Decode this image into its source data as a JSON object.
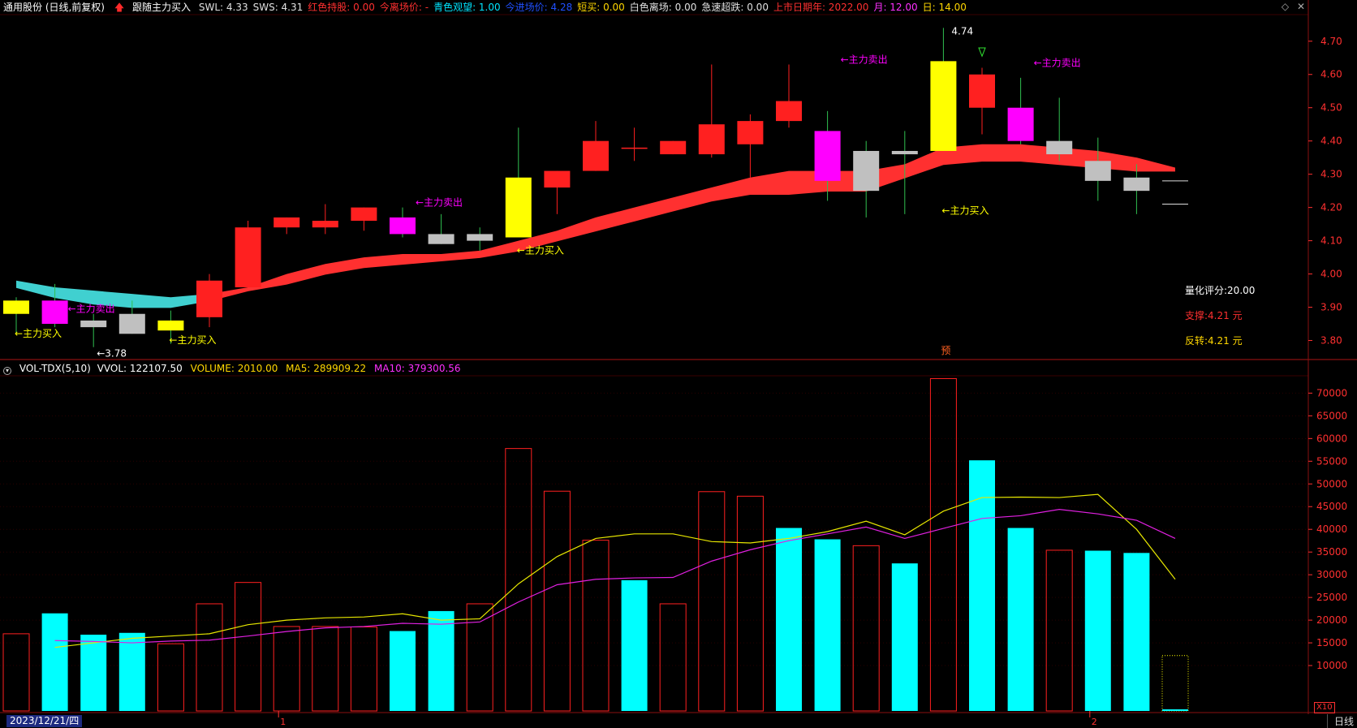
{
  "header": {
    "stock_title": "通用股份 (日线,前复权)",
    "indicator_name": "跟随主力买入",
    "items": [
      {
        "label": "SWL: 4.33",
        "color": "#e0e0e0"
      },
      {
        "label": "SWS: 4.31",
        "color": "#e0e0e0"
      },
      {
        "label": "红色持股: 0.00",
        "color": "#ff3030"
      },
      {
        "label": "今离场价: -",
        "color": "#ff3030"
      },
      {
        "label": "青色观望: 1.00",
        "color": "#00e5ff"
      },
      {
        "label": "今进场价: 4.28",
        "color": "#2050ff"
      },
      {
        "label": "短买: 0.00",
        "color": "#ffd700"
      },
      {
        "label": "白色离场: 0.00",
        "color": "#e0e0e0"
      },
      {
        "label": "急速超跌: 0.00",
        "color": "#e0e0e0"
      },
      {
        "label": "上市日期年: 2022.00",
        "color": "#ff3030"
      },
      {
        "label": "月: 12.00",
        "color": "#ff30ff"
      },
      {
        "label": "日: 14.00",
        "color": "#ffd700"
      }
    ]
  },
  "vol_header": {
    "name": "VOL-TDX(5,10)",
    "vvol": "VVOL: 122107.50",
    "volume": "VOLUME: 2010.00",
    "ma5": "MA5: 289909.22",
    "ma10": "MA10: 379300.56"
  },
  "window_icons": [
    "diamond-icon",
    "close-icon"
  ],
  "window_icon_glyphs": [
    "◇",
    "✕"
  ],
  "footer": {
    "date": "2023/12/21/四",
    "period": "日线",
    "axis_multiplier": "X10",
    "month_markers": [
      "1",
      "2"
    ]
  },
  "colors": {
    "up": "#ff2020",
    "down_cyan": "#00ffff",
    "buy_yellow": "#ffff00",
    "sell_magenta": "#ff00ff",
    "neutral_gray": "#c0c0c0",
    "band_red": "#ff3030",
    "band_cyan": "#40d0d0",
    "ma5": "#e6e600",
    "ma10": "#e020e0",
    "axis_text": "#ff3030",
    "grid": "#3a0000"
  },
  "annotations": {
    "buy_signal": "←主力买入",
    "sell_signal": "←主力卖出",
    "low_label": "←3.78",
    "high_label": "4.74",
    "pre_marker": "预"
  },
  "stats": {
    "score": "量化评分:20.00",
    "support": "支撑:4.21 元",
    "reversal": "反转:4.21 元"
  },
  "chart_data": [
    {
      "type": "candlestick",
      "y_axis_ticks": [
        "4.70",
        "4.60",
        "4.50",
        "4.40",
        "4.30",
        "4.20",
        "4.10",
        "4.00",
        "3.90",
        "3.80"
      ],
      "ylim": [
        3.75,
        4.78
      ],
      "candles": [
        {
          "o": 3.88,
          "h": 3.93,
          "l": 3.82,
          "c": 3.92,
          "color": "yellow"
        },
        {
          "o": 3.92,
          "h": 3.97,
          "l": 3.84,
          "c": 3.85,
          "color": "magenta"
        },
        {
          "o": 3.86,
          "h": 3.88,
          "l": 3.78,
          "c": 3.84,
          "color": "gray"
        },
        {
          "o": 3.82,
          "h": 3.92,
          "l": 3.82,
          "c": 3.88,
          "color": "gray"
        },
        {
          "o": 3.86,
          "h": 3.89,
          "l": 3.79,
          "c": 3.83,
          "color": "yellow"
        },
        {
          "o": 3.87,
          "h": 4.0,
          "l": 3.84,
          "c": 3.98,
          "color": "red"
        },
        {
          "o": 3.96,
          "h": 4.16,
          "l": 3.96,
          "c": 4.14,
          "color": "red"
        },
        {
          "o": 4.14,
          "h": 4.17,
          "l": 4.12,
          "c": 4.17,
          "color": "red"
        },
        {
          "o": 4.14,
          "h": 4.21,
          "l": 4.12,
          "c": 4.16,
          "color": "red"
        },
        {
          "o": 4.16,
          "h": 4.2,
          "l": 4.13,
          "c": 4.2,
          "color": "red"
        },
        {
          "o": 4.17,
          "h": 4.2,
          "l": 4.11,
          "c": 4.12,
          "color": "magenta"
        },
        {
          "o": 4.09,
          "h": 4.18,
          "l": 4.09,
          "c": 4.12,
          "color": "gray"
        },
        {
          "o": 4.1,
          "h": 4.14,
          "l": 4.07,
          "c": 4.12,
          "color": "gray"
        },
        {
          "o": 4.11,
          "h": 4.44,
          "l": 4.11,
          "c": 4.29,
          "color": "yellow"
        },
        {
          "o": 4.26,
          "h": 4.31,
          "l": 4.18,
          "c": 4.31,
          "color": "red"
        },
        {
          "o": 4.31,
          "h": 4.46,
          "l": 4.31,
          "c": 4.4,
          "color": "red"
        },
        {
          "o": 4.38,
          "h": 4.44,
          "l": 4.34,
          "c": 4.38,
          "color": "red"
        },
        {
          "o": 4.36,
          "h": 4.4,
          "l": 4.36,
          "c": 4.4,
          "color": "red"
        },
        {
          "o": 4.36,
          "h": 4.63,
          "l": 4.35,
          "c": 4.45,
          "color": "red"
        },
        {
          "o": 4.39,
          "h": 4.48,
          "l": 4.29,
          "c": 4.46,
          "color": "red"
        },
        {
          "o": 4.46,
          "h": 4.63,
          "l": 4.44,
          "c": 4.52,
          "color": "red"
        },
        {
          "o": 4.43,
          "h": 4.49,
          "l": 4.22,
          "c": 4.28,
          "color": "magenta"
        },
        {
          "o": 4.25,
          "h": 4.4,
          "l": 4.17,
          "c": 4.37,
          "color": "gray"
        },
        {
          "o": 4.37,
          "h": 4.43,
          "l": 4.18,
          "c": 4.36,
          "color": "gray"
        },
        {
          "o": 4.37,
          "h": 4.74,
          "l": 4.37,
          "c": 4.64,
          "color": "yellow"
        },
        {
          "o": 4.5,
          "h": 4.62,
          "l": 4.42,
          "c": 4.6,
          "color": "red"
        },
        {
          "o": 4.5,
          "h": 4.59,
          "l": 4.39,
          "c": 4.4,
          "color": "magenta"
        },
        {
          "o": 4.36,
          "h": 4.53,
          "l": 4.34,
          "c": 4.4,
          "color": "gray"
        },
        {
          "o": 4.34,
          "h": 4.41,
          "l": 4.22,
          "c": 4.28,
          "color": "gray"
        },
        {
          "o": 4.29,
          "h": 4.33,
          "l": 4.18,
          "c": 4.25,
          "color": "gray"
        }
      ],
      "band_upper": [
        3.98,
        3.96,
        3.95,
        3.94,
        3.93,
        3.94,
        3.96,
        4.0,
        4.03,
        4.05,
        4.06,
        4.06,
        4.07,
        4.1,
        4.13,
        4.17,
        4.2,
        4.23,
        4.26,
        4.29,
        4.31,
        4.31,
        4.31,
        4.33,
        4.38,
        4.39,
        4.39,
        4.38,
        4.37,
        4.35,
        4.32
      ],
      "band_lower": [
        3.97,
        3.94,
        3.92,
        3.91,
        3.91,
        3.93,
        3.96,
        3.98,
        4.01,
        4.03,
        4.04,
        4.05,
        4.06,
        4.08,
        4.11,
        4.14,
        4.17,
        4.2,
        4.23,
        4.25,
        4.25,
        4.26,
        4.26,
        4.3,
        4.34,
        4.35,
        4.35,
        4.34,
        4.33,
        4.32,
        4.32
      ],
      "projection_ticks": [
        4.28,
        4.21
      ],
      "labels": [
        {
          "i": 0,
          "y": 3.85,
          "kind": "buy"
        },
        {
          "i": 1,
          "y": 3.88,
          "kind": "sell"
        },
        {
          "i": 2,
          "y": 3.78,
          "kind": "low"
        },
        {
          "i": 4,
          "y": 3.83,
          "kind": "buy"
        },
        {
          "i": 10,
          "y": 4.2,
          "kind": "sell"
        },
        {
          "i": 13,
          "y": 4.1,
          "kind": "buy"
        },
        {
          "i": 21,
          "y": 4.63,
          "kind": "sell"
        },
        {
          "i": 24,
          "y": 4.74,
          "kind": "high"
        },
        {
          "i": 24,
          "y": 4.22,
          "kind": "buy"
        },
        {
          "i": 26,
          "y": 4.62,
          "kind": "sell"
        }
      ]
    },
    {
      "type": "bar",
      "y_axis_ticks": [
        "70000",
        "65000",
        "60000",
        "55000",
        "50000",
        "45000",
        "40000",
        "35000",
        "30000",
        "25000",
        "20000",
        "15000",
        "10000"
      ],
      "ylim": [
        0,
        74000
      ],
      "values": [
        17000,
        21500,
        16800,
        17200,
        14800,
        23600,
        28300,
        18600,
        18600,
        18500,
        17600,
        22000,
        23600,
        57800,
        48400,
        37600,
        28800,
        23600,
        48300,
        47300,
        40300,
        37800,
        36400,
        32500,
        73200,
        55200,
        40300,
        35400,
        35300,
        34800,
        12200
      ],
      "colors": [
        "red",
        "cyan",
        "cyan",
        "cyan",
        "red",
        "red",
        "red",
        "red",
        "red",
        "red",
        "cyan",
        "cyan",
        "red",
        "red",
        "red",
        "red",
        "cyan",
        "red",
        "red",
        "red",
        "cyan",
        "cyan",
        "red",
        "cyan",
        "red",
        "cyan",
        "cyan",
        "red",
        "cyan",
        "cyan",
        "dotted"
      ],
      "series": [
        {
          "name": "MA5",
          "values": [
            null,
            14000,
            15000,
            16000,
            16500,
            17000,
            19000,
            20000,
            20500,
            20700,
            21400,
            20000,
            20300,
            28000,
            34000,
            38000,
            39000,
            39000,
            37300,
            37000,
            38000,
            39500,
            41800,
            38800,
            44000,
            47000,
            47100,
            47000,
            47700,
            40000,
            29000
          ]
        },
        {
          "name": "MA10",
          "values": [
            null,
            15500,
            15300,
            15000,
            15400,
            15600,
            16500,
            17500,
            18300,
            18600,
            19300,
            19100,
            19600,
            24000,
            27800,
            29000,
            29300,
            29400,
            33000,
            35500,
            37500,
            39000,
            40500,
            38000,
            40200,
            42400,
            43000,
            44400,
            43400,
            42000,
            38000
          ]
        }
      ]
    }
  ]
}
